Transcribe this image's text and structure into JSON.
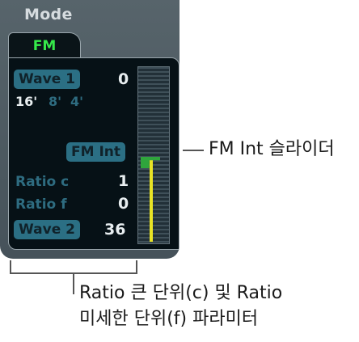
{
  "mode_label": "Mode",
  "tab": {
    "label": "FM"
  },
  "wave1": {
    "label": "Wave 1",
    "value": "0"
  },
  "octave": {
    "active": "16'",
    "inactive1": "8'",
    "inactive2": "4'"
  },
  "fm_int": {
    "label": "FM Int",
    "level": 0.48
  },
  "ratio_c": {
    "label": "Ratio c",
    "value": "1"
  },
  "ratio_f": {
    "label": "Ratio f",
    "value": "0"
  },
  "wave2": {
    "label": "Wave 2",
    "value": "36"
  },
  "callouts": {
    "fm_int": "FM Int 슬라이더",
    "ratio_line1": "Ratio 큰 단위(c) 및 Ratio",
    "ratio_line2": "미세한 단위(f) 파라미터"
  },
  "colors": {
    "panel": "#4f5c63",
    "screen": "#061116",
    "accent_green": "#36e94a",
    "label_pill": "#2b6f84",
    "slider_fill": "#e8e325"
  }
}
